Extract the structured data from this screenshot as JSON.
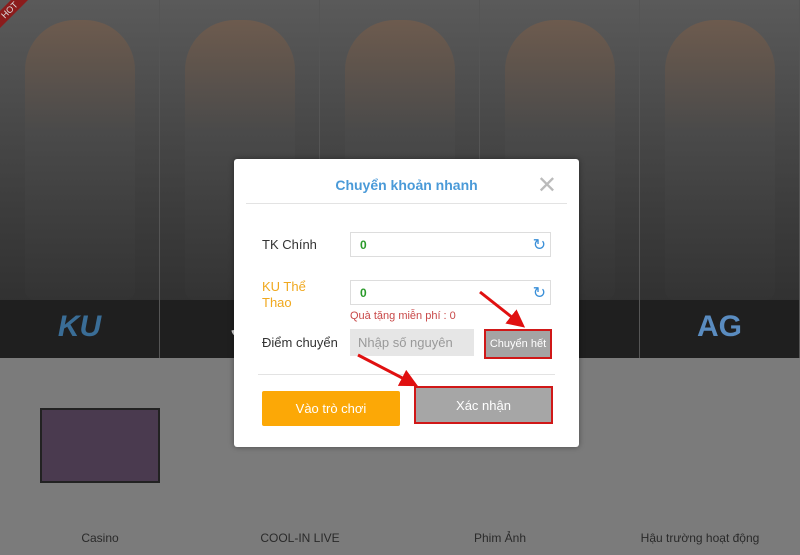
{
  "banner": {
    "hot_badge": "HOT",
    "logos": [
      "KU",
      "J",
      "",
      "et",
      "AG"
    ]
  },
  "categories": [
    {
      "label": "Casino"
    },
    {
      "label": "COOL-IN LIVE"
    },
    {
      "label": "Phim Ảnh"
    },
    {
      "label": "Hậu trường hoạt động"
    }
  ],
  "modal": {
    "title": "Chuyển khoản nhanh",
    "main_account_label": "TK Chính",
    "main_account_value": "0",
    "sport_account_label": "KU Thể Thao",
    "sport_account_value": "0",
    "gift_text": "Quà tặng miễn phí : 0",
    "points_label": "Điểm chuyển",
    "points_placeholder": "Nhập số nguyên",
    "transfer_all_label": "Chuyển hết",
    "enter_game_label": "Vào trò chơi",
    "confirm_label": "Xác nhận",
    "icons": {
      "close": "close-icon",
      "refresh": "refresh-icon"
    },
    "colors": {
      "title": "#4a9ad8",
      "enter_game": "#fca806",
      "highlight": "#d01818",
      "balance": "#2a9a2a"
    }
  }
}
